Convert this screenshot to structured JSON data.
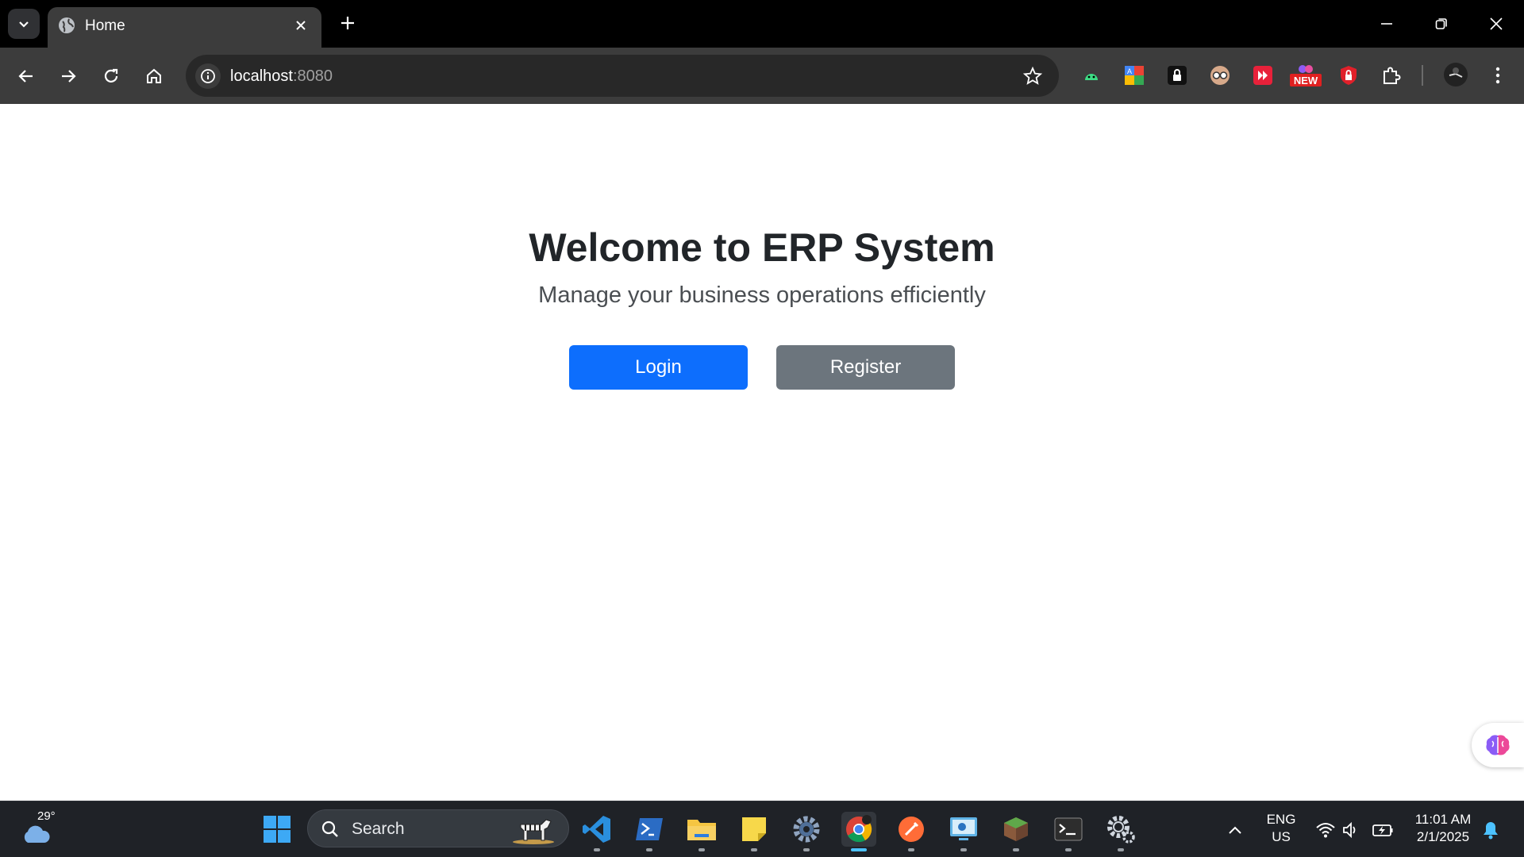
{
  "browser": {
    "tab": {
      "title": "Home"
    },
    "address": {
      "host": "localhost",
      "port": ":8080"
    },
    "extensions": [
      "android-ext-icon",
      "translate-ext-icon",
      "lock-ext-icon",
      "glasses-ext-icon",
      "media-ext-icon",
      "new-badge-ext-icon",
      "shield-ext-icon",
      "puzzle-icon"
    ],
    "new_badge": "NEW"
  },
  "page": {
    "title": "Welcome to ERP System",
    "subtitle": "Manage your business operations efficiently",
    "login_label": "Login",
    "register_label": "Register"
  },
  "colors": {
    "primary": "#0d6efd",
    "secondary": "#6c757d",
    "heading": "#212529"
  },
  "taskbar": {
    "weather_temp": "29°",
    "search_label": "Search",
    "language": "ENG",
    "region": "US",
    "time": "11:01 AM",
    "date": "2/1/2025",
    "apps": [
      "windows-start-icon",
      "vscode-icon",
      "powershell-icon",
      "file-explorer-icon",
      "sticky-notes-icon",
      "settings-gear-icon",
      "chrome-icon",
      "postman-icon",
      "remote-desktop-icon",
      "minecraft-icon",
      "terminal-icon",
      "settings-icon"
    ]
  }
}
